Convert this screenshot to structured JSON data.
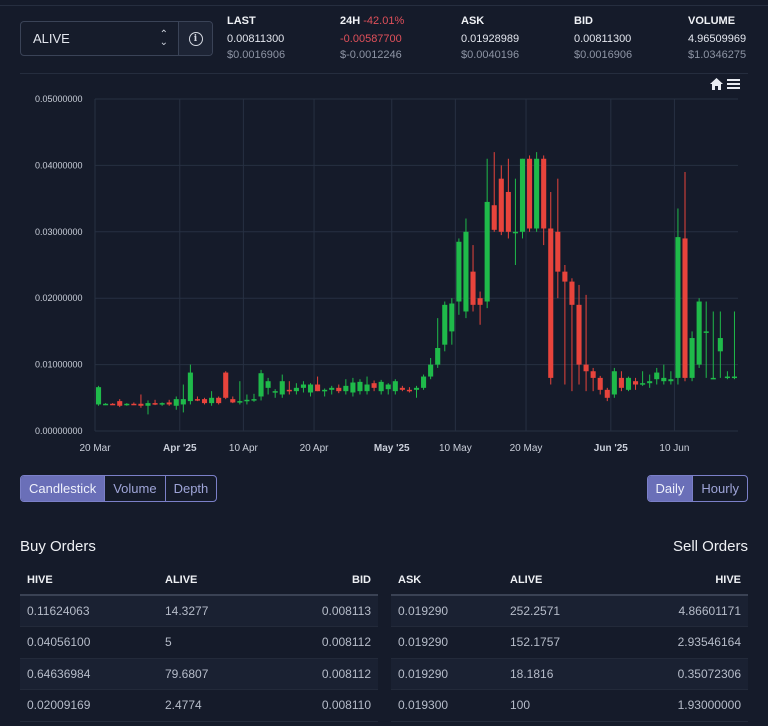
{
  "selector": {
    "token": "ALIVE"
  },
  "stats": [
    {
      "label": "LAST",
      "change": "",
      "value": "0.00811300",
      "usd": "$0.0016906",
      "neg": false
    },
    {
      "label": "24H",
      "change": "-42.01%",
      "value": "-0.00587700",
      "usd": "$-0.0012246",
      "neg": true
    },
    {
      "label": "ASK",
      "change": "",
      "value": "0.01928989",
      "usd": "$0.0040196",
      "neg": false
    },
    {
      "label": "BID",
      "change": "",
      "value": "0.00811300",
      "usd": "$0.0016906",
      "neg": false
    },
    {
      "label": "VOLUME",
      "change": "",
      "value": "4.96509969",
      "usd": "$1.0346275",
      "neg": false
    }
  ],
  "chart_tools": {
    "home_icon": "home-icon",
    "menu_icon": "menu-icon"
  },
  "chart_data": {
    "type": "candlestick",
    "title": "",
    "xlabel": "",
    "ylabel": "",
    "ylim": [
      0,
      0.05
    ],
    "y_ticks": [
      "0.00000000",
      "0.01000000",
      "0.02000000",
      "0.03000000",
      "0.04000000",
      "0.05000000"
    ],
    "x_ticks": [
      {
        "label": "20 Mar",
        "bold": false,
        "day": 0
      },
      {
        "label": "Apr '25",
        "bold": true,
        "day": 12
      },
      {
        "label": "10 Apr",
        "bold": false,
        "day": 21
      },
      {
        "label": "20 Apr",
        "bold": false,
        "day": 31
      },
      {
        "label": "May '25",
        "bold": true,
        "day": 42
      },
      {
        "label": "10 May",
        "bold": false,
        "day": 51
      },
      {
        "label": "20 May",
        "bold": false,
        "day": 61
      },
      {
        "label": "Jun '25",
        "bold": true,
        "day": 73
      },
      {
        "label": "10 Jun",
        "bold": false,
        "day": 82
      }
    ],
    "colors": {
      "up": "#1fba4a",
      "down": "#e8443c"
    },
    "candles": [
      {
        "day": 0,
        "o": 0.004,
        "h": 0.0068,
        "l": 0.0038,
        "c": 0.0066
      },
      {
        "day": 1,
        "o": 0.004,
        "h": 0.0042,
        "l": 0.0039,
        "c": 0.0041
      },
      {
        "day": 2,
        "o": 0.0041,
        "h": 0.0042,
        "l": 0.004,
        "c": 0.004
      },
      {
        "day": 3,
        "o": 0.0045,
        "h": 0.0048,
        "l": 0.0036,
        "c": 0.0038
      },
      {
        "day": 4,
        "o": 0.004,
        "h": 0.0042,
        "l": 0.0038,
        "c": 0.0041
      },
      {
        "day": 5,
        "o": 0.0041,
        "h": 0.0043,
        "l": 0.004,
        "c": 0.004
      },
      {
        "day": 6,
        "o": 0.0041,
        "h": 0.0055,
        "l": 0.0035,
        "c": 0.0038
      },
      {
        "day": 7,
        "o": 0.0038,
        "h": 0.0046,
        "l": 0.0025,
        "c": 0.0042
      },
      {
        "day": 8,
        "o": 0.0042,
        "h": 0.0047,
        "l": 0.0039,
        "c": 0.004
      },
      {
        "day": 9,
        "o": 0.004,
        "h": 0.0043,
        "l": 0.0038,
        "c": 0.0042
      },
      {
        "day": 10,
        "o": 0.0043,
        "h": 0.0047,
        "l": 0.0038,
        "c": 0.004
      },
      {
        "day": 11,
        "o": 0.0038,
        "h": 0.0052,
        "l": 0.0032,
        "c": 0.0048
      },
      {
        "day": 12,
        "o": 0.004,
        "h": 0.007,
        "l": 0.0028,
        "c": 0.0048
      },
      {
        "day": 13,
        "o": 0.0045,
        "h": 0.01,
        "l": 0.004,
        "c": 0.0088
      },
      {
        "day": 14,
        "o": 0.0048,
        "h": 0.0052,
        "l": 0.0045,
        "c": 0.0046
      },
      {
        "day": 15,
        "o": 0.0048,
        "h": 0.005,
        "l": 0.004,
        "c": 0.0042
      },
      {
        "day": 16,
        "o": 0.0042,
        "h": 0.006,
        "l": 0.0038,
        "c": 0.005
      },
      {
        "day": 17,
        "o": 0.005,
        "h": 0.0052,
        "l": 0.004,
        "c": 0.0042
      },
      {
        "day": 18,
        "o": 0.0088,
        "h": 0.009,
        "l": 0.0048,
        "c": 0.005
      },
      {
        "day": 19,
        "o": 0.0048,
        "h": 0.0052,
        "l": 0.0042,
        "c": 0.0043
      },
      {
        "day": 20,
        "o": 0.0043,
        "h": 0.0075,
        "l": 0.004,
        "c": 0.0045
      },
      {
        "day": 21,
        "o": 0.0045,
        "h": 0.0055,
        "l": 0.004,
        "c": 0.0047
      },
      {
        "day": 22,
        "o": 0.0047,
        "h": 0.0056,
        "l": 0.0044,
        "c": 0.0048
      },
      {
        "day": 23,
        "o": 0.0052,
        "h": 0.0092,
        "l": 0.0046,
        "c": 0.0087
      },
      {
        "day": 24,
        "o": 0.0065,
        "h": 0.008,
        "l": 0.0055,
        "c": 0.0075
      },
      {
        "day": 25,
        "o": 0.0058,
        "h": 0.0063,
        "l": 0.005,
        "c": 0.006
      },
      {
        "day": 26,
        "o": 0.0055,
        "h": 0.0085,
        "l": 0.005,
        "c": 0.0075
      },
      {
        "day": 27,
        "o": 0.0062,
        "h": 0.0075,
        "l": 0.0055,
        "c": 0.006
      },
      {
        "day": 28,
        "o": 0.006,
        "h": 0.0072,
        "l": 0.0055,
        "c": 0.0065
      },
      {
        "day": 29,
        "o": 0.0065,
        "h": 0.0075,
        "l": 0.0058,
        "c": 0.007
      },
      {
        "day": 30,
        "o": 0.0058,
        "h": 0.0072,
        "l": 0.0052,
        "c": 0.007
      },
      {
        "day": 31,
        "o": 0.007,
        "h": 0.0082,
        "l": 0.006,
        "c": 0.006
      },
      {
        "day": 32,
        "o": 0.006,
        "h": 0.0064,
        "l": 0.0052,
        "c": 0.0062
      },
      {
        "day": 33,
        "o": 0.0062,
        "h": 0.0068,
        "l": 0.0055,
        "c": 0.0065
      },
      {
        "day": 34,
        "o": 0.0065,
        "h": 0.007,
        "l": 0.0057,
        "c": 0.006
      },
      {
        "day": 35,
        "o": 0.006,
        "h": 0.0078,
        "l": 0.0055,
        "c": 0.0068
      },
      {
        "day": 36,
        "o": 0.0058,
        "h": 0.008,
        "l": 0.0052,
        "c": 0.0073
      },
      {
        "day": 37,
        "o": 0.006,
        "h": 0.0078,
        "l": 0.0055,
        "c": 0.0074
      },
      {
        "day": 38,
        "o": 0.006,
        "h": 0.0082,
        "l": 0.0055,
        "c": 0.007
      },
      {
        "day": 39,
        "o": 0.0072,
        "h": 0.0076,
        "l": 0.006,
        "c": 0.0065
      },
      {
        "day": 40,
        "o": 0.006,
        "h": 0.0077,
        "l": 0.0055,
        "c": 0.0074
      },
      {
        "day": 41,
        "o": 0.0063,
        "h": 0.0072,
        "l": 0.0055,
        "c": 0.007
      },
      {
        "day": 42,
        "o": 0.006,
        "h": 0.0078,
        "l": 0.0055,
        "c": 0.0075
      },
      {
        "day": 43,
        "o": 0.0065,
        "h": 0.0068,
        "l": 0.006,
        "c": 0.0062
      },
      {
        "day": 44,
        "o": 0.0062,
        "h": 0.0066,
        "l": 0.0058,
        "c": 0.006
      },
      {
        "day": 45,
        "o": 0.0062,
        "h": 0.0068,
        "l": 0.005,
        "c": 0.0065
      },
      {
        "day": 46,
        "o": 0.0065,
        "h": 0.0085,
        "l": 0.0062,
        "c": 0.0082
      },
      {
        "day": 47,
        "o": 0.0082,
        "h": 0.011,
        "l": 0.0078,
        "c": 0.01
      },
      {
        "day": 48,
        "o": 0.01,
        "h": 0.017,
        "l": 0.0095,
        "c": 0.0125
      },
      {
        "day": 49,
        "o": 0.013,
        "h": 0.0195,
        "l": 0.012,
        "c": 0.019
      },
      {
        "day": 50,
        "o": 0.015,
        "h": 0.02,
        "l": 0.013,
        "c": 0.0192
      },
      {
        "day": 51,
        "o": 0.0195,
        "h": 0.029,
        "l": 0.0175,
        "c": 0.0285
      },
      {
        "day": 52,
        "o": 0.018,
        "h": 0.032,
        "l": 0.017,
        "c": 0.03
      },
      {
        "day": 53,
        "o": 0.024,
        "h": 0.028,
        "l": 0.018,
        "c": 0.019
      },
      {
        "day": 54,
        "o": 0.02,
        "h": 0.021,
        "l": 0.016,
        "c": 0.019
      },
      {
        "day": 55,
        "o": 0.0195,
        "h": 0.041,
        "l": 0.0185,
        "c": 0.0345
      },
      {
        "day": 56,
        "o": 0.034,
        "h": 0.042,
        "l": 0.03,
        "c": 0.0303
      },
      {
        "day": 57,
        "o": 0.038,
        "h": 0.04,
        "l": 0.0295,
        "c": 0.03
      },
      {
        "day": 58,
        "o": 0.036,
        "h": 0.041,
        "l": 0.029,
        "c": 0.03
      },
      {
        "day": 59,
        "o": 0.03,
        "h": 0.038,
        "l": 0.025,
        "c": 0.03
      },
      {
        "day": 60,
        "o": 0.03,
        "h": 0.041,
        "l": 0.029,
        "c": 0.041
      },
      {
        "day": 61,
        "o": 0.041,
        "h": 0.0415,
        "l": 0.03,
        "c": 0.0305
      },
      {
        "day": 62,
        "o": 0.0305,
        "h": 0.042,
        "l": 0.03,
        "c": 0.041
      },
      {
        "day": 63,
        "o": 0.041,
        "h": 0.0415,
        "l": 0.028,
        "c": 0.0305
      },
      {
        "day": 64,
        "o": 0.0305,
        "h": 0.036,
        "l": 0.007,
        "c": 0.008
      },
      {
        "day": 65,
        "o": 0.03,
        "h": 0.038,
        "l": 0.02,
        "c": 0.024
      },
      {
        "day": 66,
        "o": 0.024,
        "h": 0.025,
        "l": 0.007,
        "c": 0.0225
      },
      {
        "day": 67,
        "o": 0.0225,
        "h": 0.023,
        "l": 0.006,
        "c": 0.019
      },
      {
        "day": 68,
        "o": 0.019,
        "h": 0.022,
        "l": 0.007,
        "c": 0.01
      },
      {
        "day": 69,
        "o": 0.01,
        "h": 0.0205,
        "l": 0.006,
        "c": 0.009
      },
      {
        "day": 70,
        "o": 0.009,
        "h": 0.0095,
        "l": 0.006,
        "c": 0.008
      },
      {
        "day": 71,
        "o": 0.008,
        "h": 0.0083,
        "l": 0.0055,
        "c": 0.0062
      },
      {
        "day": 72,
        "o": 0.0062,
        "h": 0.0065,
        "l": 0.0045,
        "c": 0.005
      },
      {
        "day": 73,
        "o": 0.0055,
        "h": 0.0095,
        "l": 0.005,
        "c": 0.009
      },
      {
        "day": 74,
        "o": 0.008,
        "h": 0.009,
        "l": 0.006,
        "c": 0.0065
      },
      {
        "day": 75,
        "o": 0.0062,
        "h": 0.0082,
        "l": 0.006,
        "c": 0.008
      },
      {
        "day": 76,
        "o": 0.0075,
        "h": 0.008,
        "l": 0.0062,
        "c": 0.007
      },
      {
        "day": 77,
        "o": 0.007,
        "h": 0.009,
        "l": 0.0068,
        "c": 0.0072
      },
      {
        "day": 78,
        "o": 0.0072,
        "h": 0.0085,
        "l": 0.0065,
        "c": 0.0075
      },
      {
        "day": 79,
        "o": 0.0078,
        "h": 0.0095,
        "l": 0.007,
        "c": 0.0088
      },
      {
        "day": 80,
        "o": 0.0075,
        "h": 0.01,
        "l": 0.007,
        "c": 0.008
      },
      {
        "day": 81,
        "o": 0.0075,
        "h": 0.009,
        "l": 0.007,
        "c": 0.0078
      },
      {
        "day": 82,
        "o": 0.008,
        "h": 0.0335,
        "l": 0.007,
        "c": 0.0292
      },
      {
        "day": 83,
        "o": 0.029,
        "h": 0.039,
        "l": 0.0075,
        "c": 0.008
      },
      {
        "day": 84,
        "o": 0.008,
        "h": 0.015,
        "l": 0.0075,
        "c": 0.014
      },
      {
        "day": 85,
        "o": 0.01,
        "h": 0.02,
        "l": 0.0095,
        "c": 0.0195
      },
      {
        "day": 86,
        "o": 0.015,
        "h": 0.0195,
        "l": 0.008,
        "c": 0.015
      },
      {
        "day": 87,
        "o": 0.008,
        "h": 0.018,
        "l": 0.0078,
        "c": 0.008
      },
      {
        "day": 88,
        "o": 0.012,
        "h": 0.018,
        "l": 0.008,
        "c": 0.014
      },
      {
        "day": 89,
        "o": 0.008,
        "h": 0.009,
        "l": 0.0078,
        "c": 0.0082
      },
      {
        "day": 90,
        "o": 0.008,
        "h": 0.018,
        "l": 0.0078,
        "c": 0.0082
      }
    ]
  },
  "chart_view_tabs": [
    "Candlestick",
    "Volume",
    "Depth"
  ],
  "chart_view_active": "Candlestick",
  "interval_tabs": [
    "Daily",
    "Hourly"
  ],
  "interval_active": "Daily",
  "buy_orders": {
    "title": "Buy Orders",
    "headers": [
      "HIVE",
      "ALIVE",
      "BID"
    ],
    "rows": [
      [
        "0.11624063",
        "14.3277",
        "0.008113"
      ],
      [
        "0.04056100",
        "5",
        "0.008112"
      ],
      [
        "0.64636984",
        "79.6807",
        "0.008112"
      ],
      [
        "0.02009169",
        "2.4774",
        "0.008110"
      ]
    ]
  },
  "sell_orders": {
    "title": "Sell Orders",
    "headers": [
      "ASK",
      "ALIVE",
      "HIVE"
    ],
    "rows": [
      [
        "0.019290",
        "252.2571",
        "4.86601171"
      ],
      [
        "0.019290",
        "152.1757",
        "2.93546164"
      ],
      [
        "0.019290",
        "18.1816",
        "0.35072306"
      ],
      [
        "0.019300",
        "100",
        "1.93000000"
      ]
    ]
  }
}
